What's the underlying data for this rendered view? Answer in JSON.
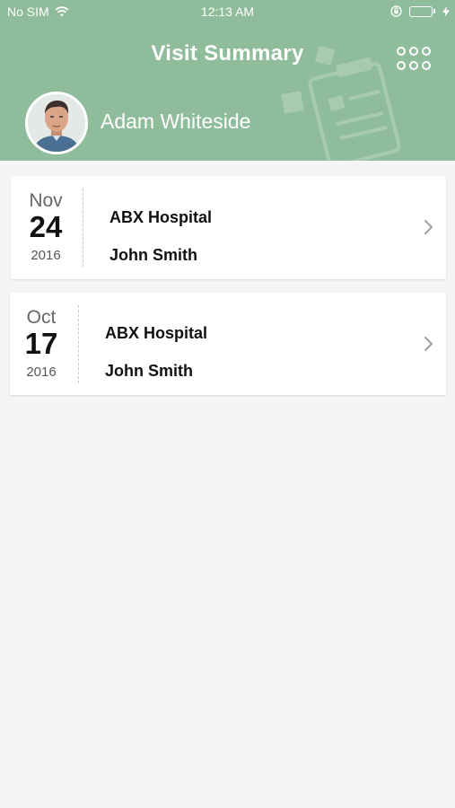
{
  "status_bar": {
    "carrier": "No SIM",
    "time": "12:13 AM",
    "icons": [
      "wifi-icon",
      "lock-rotation-icon",
      "battery-icon",
      "charging-bolt-icon"
    ],
    "battery_color": "#5ee06a"
  },
  "header": {
    "title": "Visit Summary",
    "menu_icon": "grid-menu-icon",
    "background_color": "#8fbc9b",
    "user": {
      "name": "Adam Whiteside",
      "avatar_icon": "user-avatar"
    }
  },
  "visits": [
    {
      "month": "Nov",
      "day": "24",
      "year": "2016",
      "hospital": "ABX Hospital",
      "doctor": "John Smith"
    },
    {
      "month": "Oct",
      "day": "17",
      "year": "2016",
      "hospital": "ABX Hospital",
      "doctor": "John Smith"
    }
  ]
}
